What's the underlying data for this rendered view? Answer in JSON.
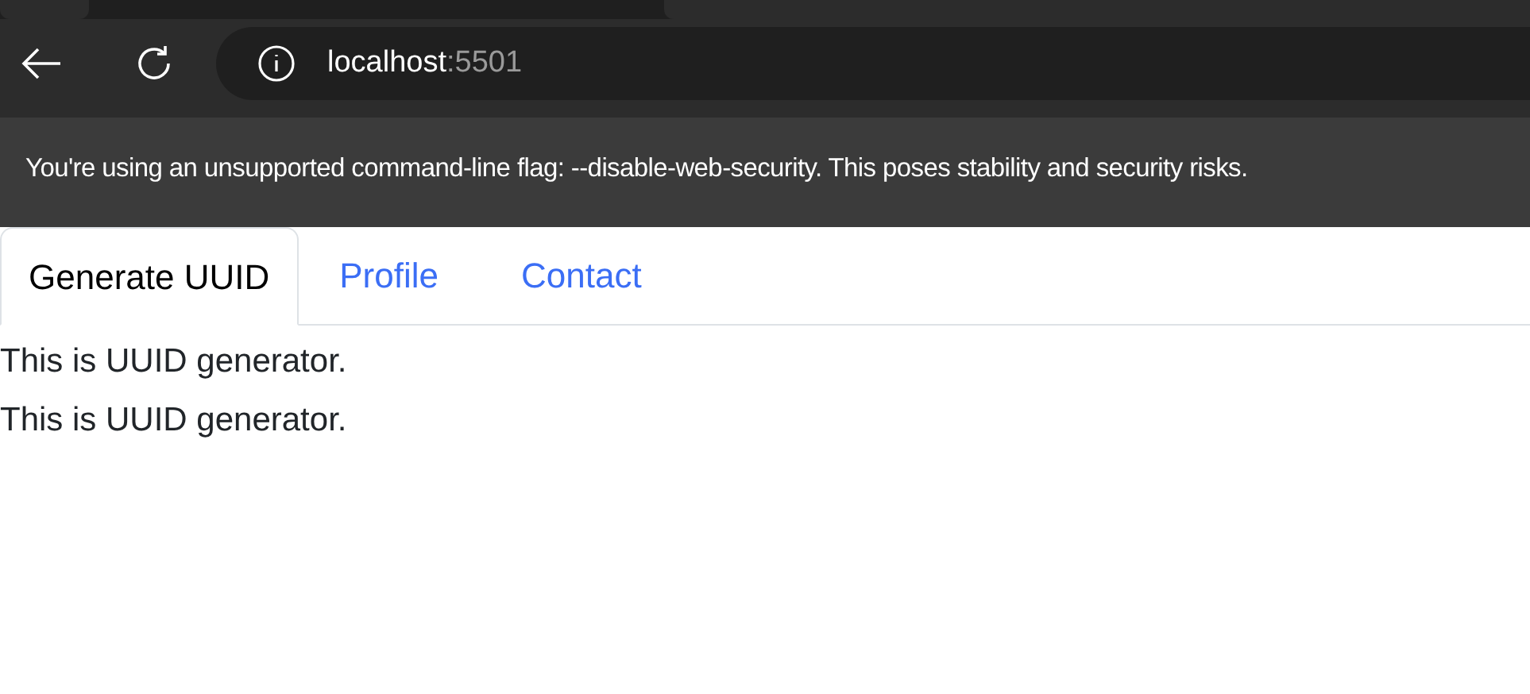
{
  "address_bar": {
    "host": "localhost",
    "port": ":5501"
  },
  "infobar": {
    "message": "You're using an unsupported command-line flag: --disable-web-security. This poses stability and security risks."
  },
  "tabs": [
    {
      "label": "Generate UUID",
      "selected": true
    },
    {
      "label": "Profile",
      "selected": false
    },
    {
      "label": "Contact",
      "selected": false
    }
  ],
  "content": [
    "This is UUID generator.",
    "This is UUID generator."
  ]
}
